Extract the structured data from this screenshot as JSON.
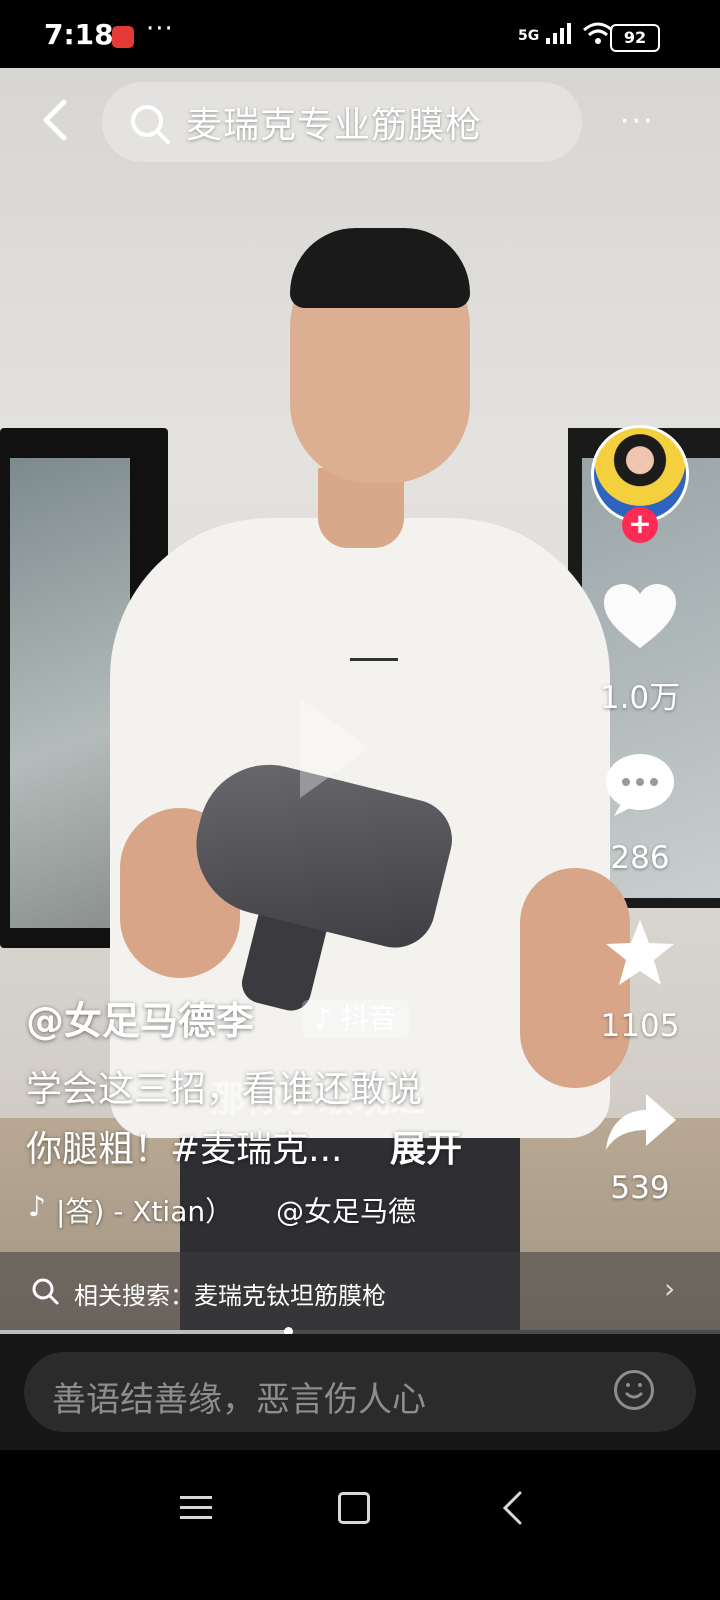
{
  "status_bar": {
    "time": "7:18",
    "more": "···",
    "network": "5G",
    "battery": "92"
  },
  "top_bar": {
    "search_text": "麦瑞克专业筋膜枪",
    "more": "···"
  },
  "right_rail": {
    "like_count": "1.0万",
    "comment_count": "286",
    "favorite_count": "1105",
    "share_count": "539"
  },
  "caption": {
    "author": "@女足马德李",
    "tag": "抖音",
    "subtitle_overlay": "那你了级现过",
    "line1": "学会这三招，看谁还敢说",
    "line2": "你腿粗！#麦瑞克...",
    "expand": "展开",
    "music": "|答) - Xtian）",
    "music_author": "@女足马德"
  },
  "related": {
    "text": "相关搜索：麦瑞克钛坦筋膜枪"
  },
  "playback": {
    "progress": 0.4
  },
  "comment": {
    "placeholder": "善语结善缘，恶言伤人心"
  },
  "colors": {
    "follow": "#fe2c55",
    "bar": "#161616"
  }
}
